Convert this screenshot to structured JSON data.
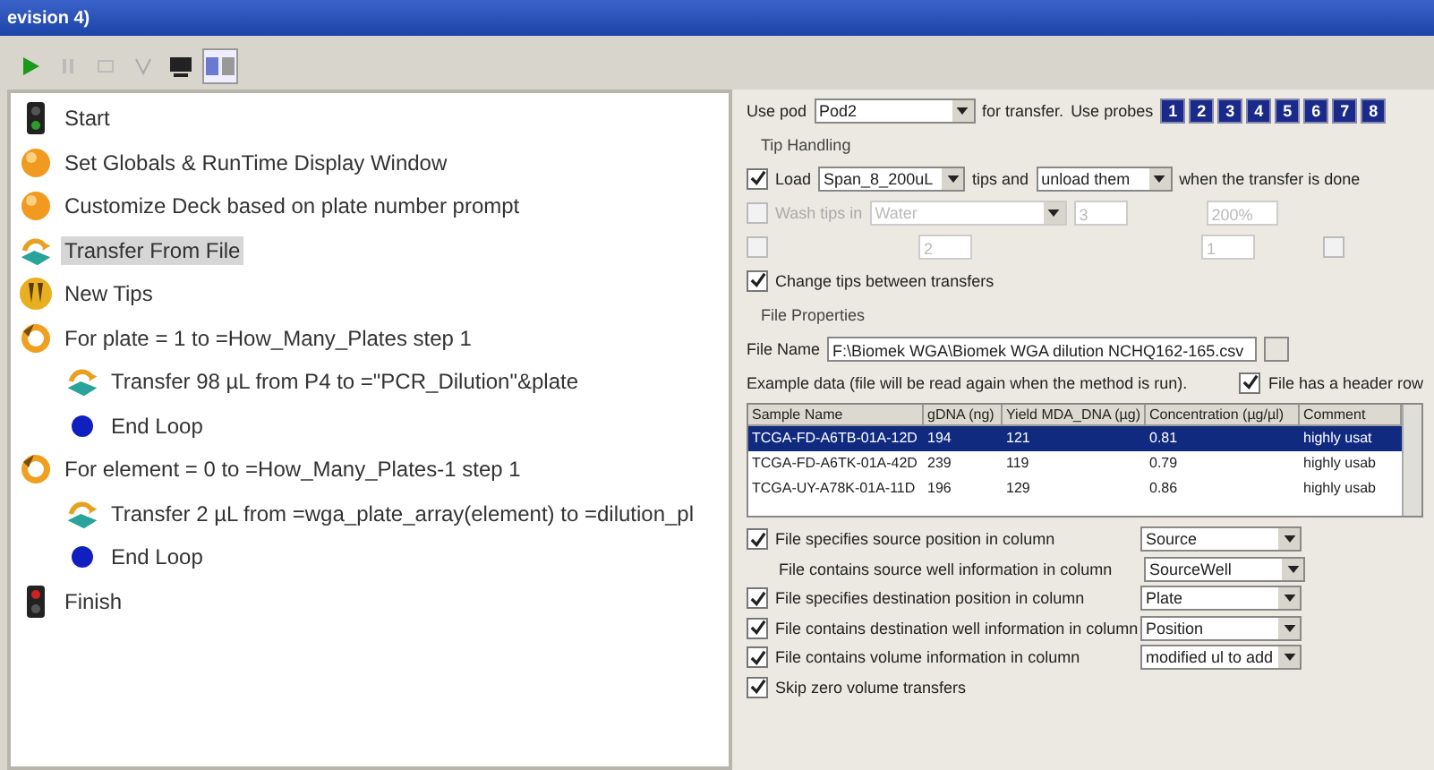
{
  "window": {
    "title": "evision 4)"
  },
  "steps": [
    {
      "kind": "start",
      "label": "Start",
      "selected": false
    },
    {
      "kind": "ball",
      "label": "Set Globals & RunTime Display Window",
      "selected": false
    },
    {
      "kind": "ball",
      "label": "Customize Deck based on plate number prompt",
      "selected": false
    },
    {
      "kind": "transfer",
      "label": "Transfer From File",
      "selected": true
    },
    {
      "kind": "tips",
      "label": "New Tips",
      "selected": false
    },
    {
      "kind": "loop",
      "label": "For plate = 1 to =How_Many_Plates step 1",
      "selected": false,
      "children": [
        {
          "kind": "transfer",
          "label": "Transfer 98 µL from P4 to =\"PCR_Dilution\"&plate",
          "selected": false
        },
        {
          "kind": "endloop",
          "label": "End Loop",
          "selected": false
        }
      ]
    },
    {
      "kind": "loop",
      "label": "For element = 0 to =How_Many_Plates-1 step 1",
      "selected": false,
      "children": [
        {
          "kind": "transfer",
          "label": "Transfer 2 µL from =wga_plate_array(element) to =dilution_pl",
          "selected": false
        },
        {
          "kind": "endloop",
          "label": "End Loop",
          "selected": false
        }
      ]
    },
    {
      "kind": "finish",
      "label": "Finish",
      "selected": false
    }
  ],
  "pod_row": {
    "use_label": "Use pod",
    "pod": "Pod2",
    "for_label": "for transfer.",
    "probes_label": "Use probes",
    "probes": [
      {
        "label": "1",
        "selected": true
      },
      {
        "label": "2",
        "selected": true
      },
      {
        "label": "3",
        "selected": true
      },
      {
        "label": "4",
        "selected": true
      },
      {
        "label": "5",
        "selected": true
      },
      {
        "label": "6",
        "selected": true
      },
      {
        "label": "7",
        "selected": true
      },
      {
        "label": "8",
        "selected": true
      }
    ]
  },
  "tip_handling": {
    "heading": "Tip Handling",
    "load": {
      "checked": true,
      "label": "Load",
      "tip_type": "Span_8_200uL",
      "middle": "tips and",
      "action": "unload them",
      "end": "when the transfer is done"
    },
    "wash": {
      "checked": false,
      "disabled": true,
      "label": "Wash tips in",
      "liquid": "Water",
      "count": "3",
      "percent": "200%"
    },
    "extra": {
      "checked": false,
      "disabled": true,
      "field_1": "2",
      "field_2": "1",
      "checked_2": false
    },
    "change_tips": {
      "checked": true,
      "label": "Change tips between transfers"
    }
  },
  "file_properties": {
    "heading": "File Properties",
    "file_name_label": "File Name",
    "file_name": "F:\\Biomek WGA\\Biomek WGA dilution NCHQ162-165.csv",
    "example_note": "Example data (file will be read again when the method is run).",
    "header_row": {
      "checked": true,
      "label": "File has a header row"
    },
    "table": {
      "columns": [
        "Sample Name",
        "gDNA (ng)",
        "Yield MDA_DNA (µg)",
        "Concentration (µg/µl)",
        "Comment"
      ],
      "rows": [
        {
          "selected": true,
          "cells": [
            "TCGA-FD-A6TB-01A-12D",
            "194",
            "121",
            "0.81",
            "highly usat"
          ]
        },
        {
          "selected": false,
          "cells": [
            "TCGA-FD-A6TK-01A-42D",
            "239",
            "119",
            "0.79",
            "highly usab"
          ]
        },
        {
          "selected": false,
          "cells": [
            "TCGA-UY-A78K-01A-11D",
            "196",
            "129",
            "0.86",
            "highly usab"
          ]
        }
      ]
    },
    "options": [
      {
        "kind": "check",
        "checked": true,
        "label": "File specifies source position in column",
        "value": "Source"
      },
      {
        "kind": "plain",
        "label": "File contains source well information in column",
        "value": "SourceWell"
      },
      {
        "kind": "check",
        "checked": true,
        "label": "File specifies destination position in column",
        "value": "Plate"
      },
      {
        "kind": "check",
        "checked": true,
        "label": "File contains destination well information in column",
        "value": "Position"
      },
      {
        "kind": "check",
        "checked": true,
        "label": "File contains volume information in column",
        "value": "modified ul to add"
      },
      {
        "kind": "checkonly",
        "checked": true,
        "label": "Skip zero volume transfers"
      }
    ]
  }
}
